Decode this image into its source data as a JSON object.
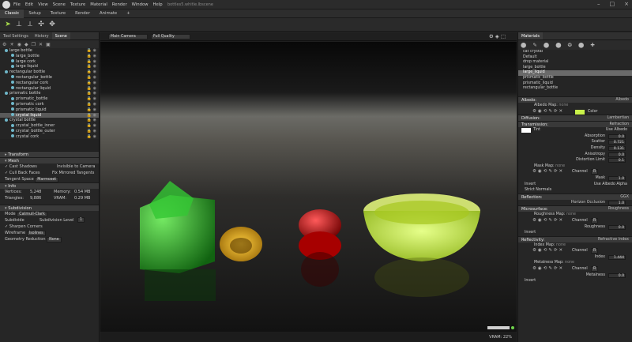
{
  "app": {
    "doc_title": "bottles5.whitle.lbscene",
    "menus": [
      "File",
      "Edit",
      "View",
      "Scene",
      "Texture",
      "Material",
      "Render",
      "Window",
      "Help"
    ]
  },
  "mode_tabs": [
    "Classic",
    "Setup",
    "Texture",
    "Render",
    "Animate",
    "+"
  ],
  "left": {
    "tabs": [
      "Tool Settings",
      "History",
      "Scene"
    ],
    "tree": [
      "large bottle",
      "large_bottle",
      "large cork",
      "large liquid",
      "rectangular bottle",
      "rectangular_bottle",
      "rectangular cork",
      "rectangular liquid",
      "prismatic bottle",
      "prismatic_bottle",
      "prismatic cork",
      "prismatic liquid",
      "crystal liquid",
      "crystal bottle",
      "crystal_bottle_inner",
      "crystal_bottle_outer",
      "crystal cork"
    ],
    "transform": "Transform",
    "mesh": "Mesh",
    "cast_shadows": "Cast Shadows",
    "invisible_camera": "Invisible to Camera",
    "cull_back": "Cull Back Faces",
    "fix_mirrored": "Fix Mirrored Tangents",
    "tangent_space_label": "Tangent Space",
    "tangent_space_value": "Marmoset",
    "info": "Info",
    "vertices_label": "Vertices:",
    "vertices": "5,248",
    "memory_label": "Memory:",
    "memory": "0.54 MB",
    "triangles_label": "Triangles:",
    "triangles": "9,886",
    "vram_label": "VRAM:",
    "vram": "0.29 MB",
    "subdivision": "Subdivision",
    "mode_label": "Mode",
    "mode_value": "Catmull-Clark",
    "subdivide": "Subdivide",
    "subdiv_level_label": "Subdivision Level",
    "subdiv_level": "1",
    "sharpen": "Sharpen Corners",
    "wireframe_label": "Wireframe",
    "wireframe_value": "Isolines",
    "geom_red_label": "Geometry Reduction",
    "geom_red_value": "None"
  },
  "viewport": {
    "camera": "Main Camera",
    "quality": "Full Quality",
    "vram_status": "VRAM: 22%"
  },
  "right": {
    "tab": "Materials",
    "materials": [
      "cat crystal",
      "Default",
      "drop material",
      "large_bottle",
      "large_liquid",
      "prismatic_bottle",
      "prismatic_liquid",
      "rectangular_bottle"
    ],
    "albedo": "Albedo:",
    "albedo_type": "Albedo",
    "albedo_map": "Albedo Map:",
    "albedo_map_v": "none",
    "color": "Color",
    "diffusion": "Diffusion:",
    "diffusion_type": "Lambertian",
    "transmission": "Transmission:",
    "transmission_type": "Refraction",
    "tint": "Tint",
    "use_albedo": "Use Albedo",
    "absorption": "Absorption",
    "absorption_v": "0.0",
    "scatter": "Scatter",
    "scatter_v": "0.721",
    "density": "Density",
    "density_v": "0.131",
    "anisotropy": "Anisotropy",
    "anisotropy_v": "0.0",
    "distortion": "Distortion Limit",
    "distortion_v": "0.1",
    "mask_map": "Mask Map:",
    "mask_map_v": "none",
    "channel": "Channel",
    "channel_v": "R",
    "mask": "Mask",
    "mask_v": "1.0",
    "invert": "Invert",
    "use_albedo_alpha": "Use Albedo Alpha",
    "strict_normals": "Strict Normals",
    "reflection": "Reflection:",
    "reflection_type": "GGX",
    "horizon": "Horizon Occlusion",
    "horizon_v": "1.0",
    "microsurface": "Microsurface:",
    "microsurface_type": "Roughness",
    "rough_map": "Roughness Map:",
    "rough_map_v": "none",
    "roughness": "Roughness",
    "roughness_v": "0.0",
    "invert2": "Invert",
    "reflectivity": "Reflectivity:",
    "reflectivity_type": "Refractive Index",
    "index_map": "Index Map:",
    "index_map_v": "none",
    "index": "Index",
    "index_v": "1.444",
    "metal_map": "Metalness Map:",
    "metal_map_v": "none",
    "metalness": "Metalness",
    "metalness_v": "0.0",
    "invert3": "Invert"
  }
}
